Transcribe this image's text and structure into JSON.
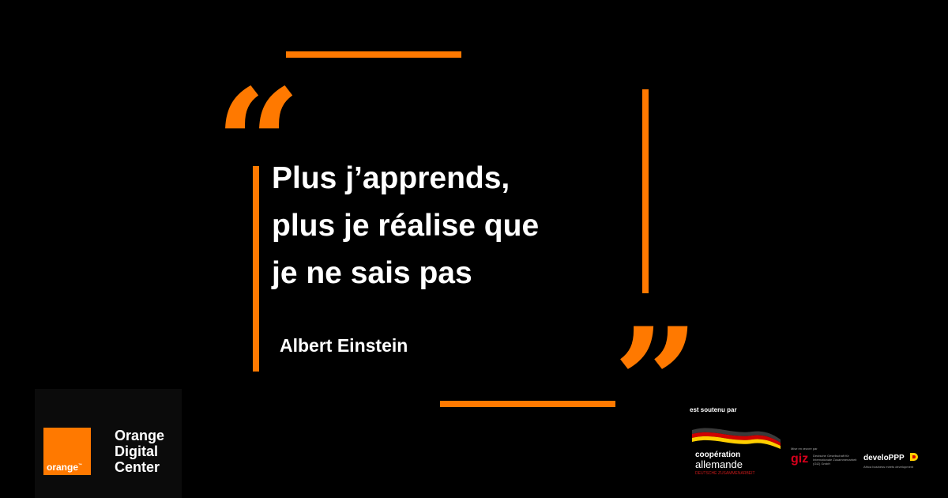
{
  "colors": {
    "accent": "#ff7900",
    "background": "#000000",
    "text": "#ffffff"
  },
  "quote": {
    "open_mark": "“",
    "close_mark": "”",
    "lines": [
      "Plus j’apprends,",
      "plus je réalise que",
      "je ne sais pas"
    ],
    "author": "Albert Einstein"
  },
  "branding": {
    "logo_word": "orange",
    "logo_trademark": "™",
    "name_lines": [
      "Orange",
      "Digital",
      "Center"
    ]
  },
  "sponsors": {
    "heading": "est soutenu par",
    "cooperation": {
      "line1": "coopération",
      "line2": "allemande",
      "line3": "DEUTSCHE ZUSAMMENARBEIT",
      "icon": "german-flag-wave-icon"
    },
    "giz": {
      "above": "Mise en œuvre par",
      "word": "giz",
      "desc": "Deutsche Gesellschaft für Internationale Zusammenarbeit (GIZ) GmbH"
    },
    "developpp": {
      "word": "develoPPP",
      "tag": "Africa business meets development",
      "icon": "developpp-mark-icon"
    }
  }
}
